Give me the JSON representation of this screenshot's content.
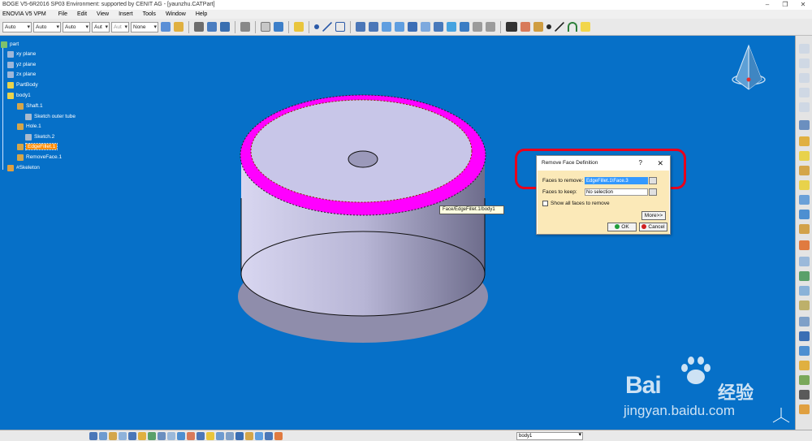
{
  "window": {
    "title": "BOGE V5-6R2016 SP03 Environment: supported by CENIT AG - [yaunzhu.CATPart]",
    "minimize": "–",
    "restore": "❐",
    "close": "✕"
  },
  "menu": {
    "brand": "ENOVIA V5 VPM",
    "items": [
      "File",
      "Edit",
      "View",
      "Insert",
      "Tools",
      "Window",
      "Help"
    ]
  },
  "toolbar": {
    "combos": [
      "Auto",
      "Auto",
      "Auto",
      "Aut",
      "Aut",
      "None"
    ]
  },
  "tree": {
    "root": "part",
    "items": [
      {
        "label": "xy plane",
        "icon": "plane-icon"
      },
      {
        "label": "yz plane",
        "icon": "plane-icon"
      },
      {
        "label": "zx plane",
        "icon": "plane-icon"
      },
      {
        "label": "PartBody",
        "icon": "body-icon"
      },
      {
        "label": "body1",
        "icon": "body-icon"
      },
      {
        "label": "Shaft.1",
        "icon": "shaft-icon"
      },
      {
        "label": "Sketch outer tube",
        "icon": "sketch-icon"
      },
      {
        "label": "Hole.1",
        "icon": "hole-icon"
      },
      {
        "label": "Sketch.2",
        "icon": "sketch-icon"
      },
      {
        "label": "EdgeFillet.1",
        "icon": "fillet-icon"
      },
      {
        "label": "RemoveFace.1",
        "icon": "remove-face-icon"
      },
      {
        "label": "#Skeleton",
        "icon": "skeleton-icon"
      }
    ]
  },
  "viewport": {
    "tooltip": "Face/EdgeFillet.1/body1"
  },
  "dialog": {
    "title": "Remove Face Definition",
    "help": "?",
    "close": "✕",
    "faces_to_remove_label": "Faces to remove:",
    "faces_to_remove_value": "EdgeFillet.1\\Face.3",
    "faces_to_keep_label": "Faces to keep:",
    "faces_to_keep_value": "No selection",
    "show_all_label": "Show all faces to remove",
    "show_all_checked": false,
    "more_label": "More>>",
    "ok_label": "OK",
    "cancel_label": "Cancel"
  },
  "statusbar": {
    "combo_value": "body1"
  },
  "watermark": {
    "brand": "Bai",
    "suffix": "经验",
    "url": "jingyan.baidu.com"
  },
  "colors": {
    "background": "#0670c8",
    "model_body": "#c8c6e8",
    "fillet_highlight": "#ff00ff",
    "selection_ring": "#e8001c",
    "dialog_body": "#fbe9b8"
  }
}
